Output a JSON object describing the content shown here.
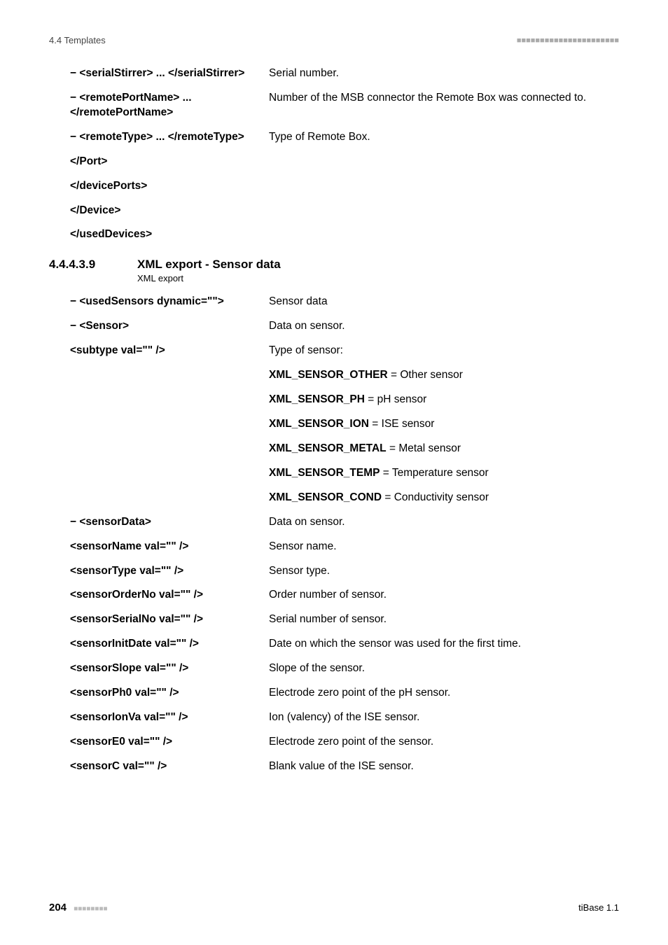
{
  "header": {
    "left": "4.4 Templates",
    "right": "■■■■■■■■■■■■■■■■■■■■■■"
  },
  "top_rows": [
    {
      "left": "− <serialStirrer> ... </serialStirrer>",
      "right": "Serial number."
    },
    {
      "left": "− <remotePortName> ... </remotePortName>",
      "right": "Number of the MSB connector the Remote Box was connected to."
    },
    {
      "left": "− <remoteType> ... </remoteType>",
      "right": "Type of Remote Box."
    },
    {
      "left": "</Port>",
      "right": ""
    },
    {
      "left": "</devicePorts>",
      "right": ""
    },
    {
      "left": "</Device>",
      "right": ""
    },
    {
      "left": "</usedDevices>",
      "right": ""
    }
  ],
  "section": {
    "num": "4.4.4.3.9",
    "title": "XML export - Sensor data",
    "sub": "XML export"
  },
  "sensor_rows": [
    {
      "left": "− <usedSensors dynamic=\"\">",
      "right_plain": "Sensor data"
    },
    {
      "left": "− <Sensor>",
      "right_plain": "Data on sensor."
    },
    {
      "left": "<subtype val=\"\" />",
      "right_plain": "Type of sensor:"
    },
    {
      "left": "",
      "right_bold": "XML_SENSOR_OTHER",
      "right_tail": " = Other sensor"
    },
    {
      "left": "",
      "right_bold": "XML_SENSOR_PH",
      "right_tail": " = pH sensor"
    },
    {
      "left": "",
      "right_bold": "XML_SENSOR_ION",
      "right_tail": " = ISE sensor"
    },
    {
      "left": "",
      "right_bold": "XML_SENSOR_METAL",
      "right_tail": " = Metal sensor"
    },
    {
      "left": "",
      "right_bold": "XML_SENSOR_TEMP",
      "right_tail": " = Temperature sensor"
    },
    {
      "left": "",
      "right_bold": "XML_SENSOR_COND",
      "right_tail": " = Conductivity sensor"
    },
    {
      "left": "− <sensorData>",
      "right_plain": "Data on sensor."
    },
    {
      "left": "<sensorName val=\"\" />",
      "right_plain": "Sensor name."
    },
    {
      "left": "<sensorType val=\"\" />",
      "right_plain": "Sensor type."
    },
    {
      "left": "<sensorOrderNo val=\"\" />",
      "right_plain": "Order number of sensor."
    },
    {
      "left": "<sensorSerialNo val=\"\" />",
      "right_plain": "Serial number of sensor."
    },
    {
      "left": "<sensorInitDate val=\"\" />",
      "right_plain": "Date on which the sensor was used for the first time."
    },
    {
      "left": "<sensorSlope val=\"\" />",
      "right_plain": "Slope of the sensor."
    },
    {
      "left": "<sensorPh0 val=\"\" />",
      "right_plain": "Electrode zero point of the pH sensor."
    },
    {
      "left": "<sensorIonVa val=\"\" />",
      "right_plain": "Ion (valency) of the ISE sensor."
    },
    {
      "left": "<sensorE0 val=\"\" />",
      "right_plain": "Electrode zero point of the sensor."
    },
    {
      "left": "<sensorC val=\"\" />",
      "right_plain": "Blank value of the ISE sensor."
    }
  ],
  "footer": {
    "page": "204",
    "squares": "■■■■■■■■",
    "right": "tiBase 1.1"
  }
}
